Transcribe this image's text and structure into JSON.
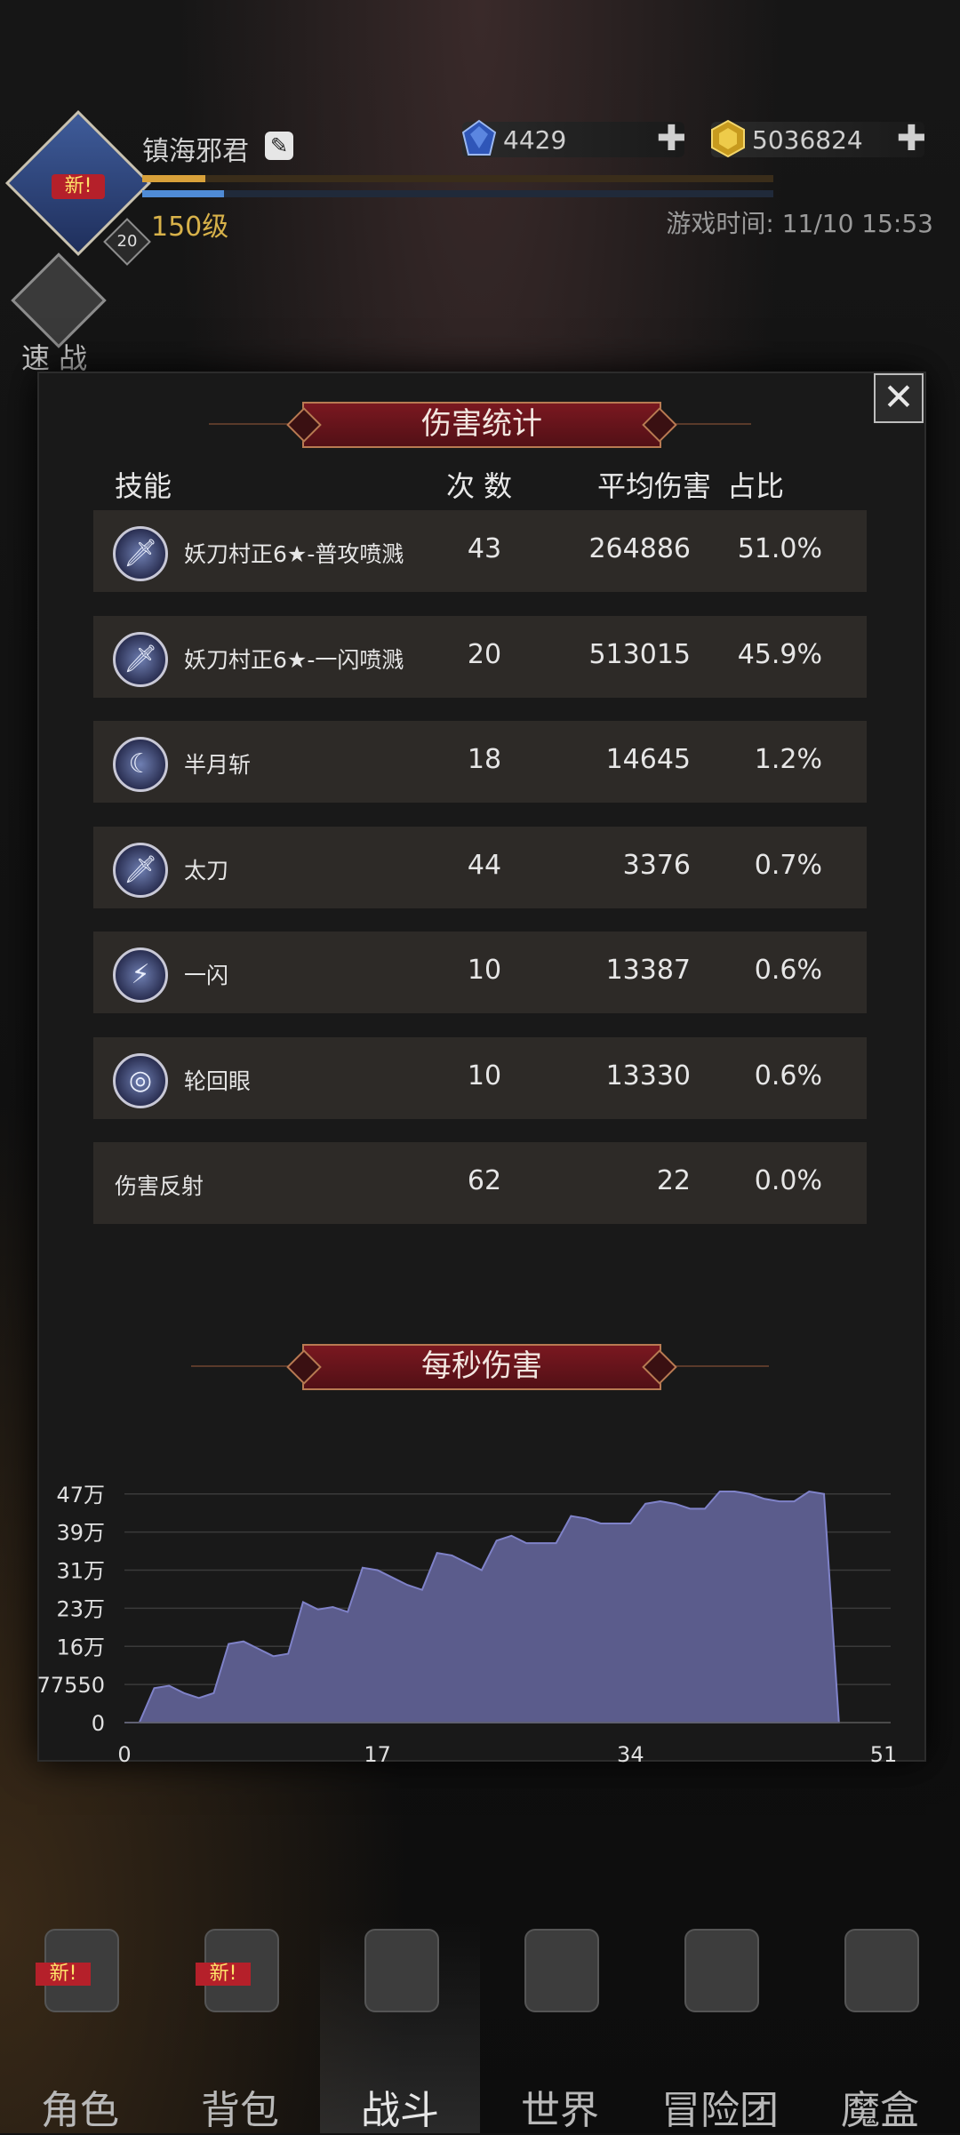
{
  "player": {
    "name": "镇海邪君",
    "level": "150级",
    "badge_new": "新!",
    "avatar_level": "20",
    "xp_fraction": 0.1,
    "hp_fraction": 0.13
  },
  "resources": {
    "gems": "4429",
    "gold": "5036824",
    "plus": "✚"
  },
  "game_time": "游戏时间: 11/10 15:53",
  "quick_battle": {
    "label": "速 战"
  },
  "close": "✕",
  "damage_stats": {
    "title": "伤害统计",
    "columns": {
      "skill": "技能",
      "count": "次 数",
      "avg": "平均伤害",
      "pct": "占比"
    },
    "rows": [
      {
        "icon": "sword-icon",
        "glyph": "🗡",
        "name": "妖刀村正6★-普攻喷溅",
        "count": "43",
        "avg": "264886",
        "pct": "51.0%"
      },
      {
        "icon": "sword-icon",
        "glyph": "🗡",
        "name": "妖刀村正6★-一闪喷溅",
        "count": "20",
        "avg": "513015",
        "pct": "45.9%"
      },
      {
        "icon": "crescent-moon-icon",
        "glyph": "☾",
        "name": "半月斩",
        "count": "18",
        "avg": "14645",
        "pct": "1.2%"
      },
      {
        "icon": "katana-icon",
        "glyph": "🗡",
        "name": "太刀",
        "count": "44",
        "avg": "3376",
        "pct": "0.7%"
      },
      {
        "icon": "flash-slash-icon",
        "glyph": "⚡",
        "name": "一闪",
        "count": "10",
        "avg": "13387",
        "pct": "0.6%"
      },
      {
        "icon": "spiral-eye-icon",
        "glyph": "◎",
        "name": "轮回眼",
        "count": "10",
        "avg": "13330",
        "pct": "0.6%"
      },
      {
        "icon": "",
        "glyph": "",
        "name": "伤害反射",
        "count": "62",
        "avg": "22",
        "pct": "0.0%"
      }
    ]
  },
  "dps": {
    "title": "每秒伤害"
  },
  "chart_data": {
    "type": "area",
    "title": "每秒伤害",
    "xlabel": "",
    "ylabel": "",
    "xlim": [
      0,
      51
    ],
    "ylim": [
      0,
      470000
    ],
    "x_ticks": [
      "0",
      "17",
      "34",
      "51"
    ],
    "x_tick_values": [
      0,
      17,
      34,
      51
    ],
    "y_ticks": [
      "0",
      "77550",
      "16万",
      "23万",
      "31万",
      "39万",
      "47万"
    ],
    "y_tick_values": [
      0,
      77550,
      155000,
      232500,
      310000,
      387500,
      465000
    ],
    "grid": true,
    "color": "#5b5c8c",
    "x": [
      0,
      1,
      2,
      3,
      4,
      5,
      6,
      7,
      8,
      9,
      10,
      11,
      12,
      13,
      14,
      15,
      16,
      17,
      18,
      19,
      20,
      21,
      22,
      23,
      24,
      25,
      26,
      27,
      28,
      29,
      30,
      31,
      32,
      33,
      34,
      35,
      36,
      37,
      38,
      39,
      40,
      41,
      42,
      43,
      44,
      45,
      46,
      47,
      48
    ],
    "y": [
      0,
      0,
      70000,
      75000,
      60000,
      50000,
      60000,
      160000,
      165000,
      150000,
      135000,
      140000,
      245000,
      230000,
      235000,
      225000,
      315000,
      310000,
      295000,
      280000,
      270000,
      345000,
      340000,
      325000,
      310000,
      370000,
      380000,
      365000,
      365000,
      365000,
      420000,
      415000,
      405000,
      405000,
      405000,
      445000,
      450000,
      445000,
      435000,
      435000,
      470000,
      470000,
      465000,
      455000,
      450000,
      450000,
      470000,
      465000,
      0
    ]
  },
  "nav": [
    {
      "label": "角色",
      "icon": "helmet-icon",
      "new": "新!"
    },
    {
      "label": "背包",
      "icon": "backpack-icon",
      "new": "新!"
    },
    {
      "label": "战斗",
      "icon": "sword-shield-icon",
      "new": ""
    },
    {
      "label": "世界",
      "icon": "map-scroll-icon",
      "new": ""
    },
    {
      "label": "冒险团",
      "icon": "castle-icon",
      "new": ""
    },
    {
      "label": "魔盒",
      "icon": "magic-box-icon",
      "new": ""
    }
  ]
}
